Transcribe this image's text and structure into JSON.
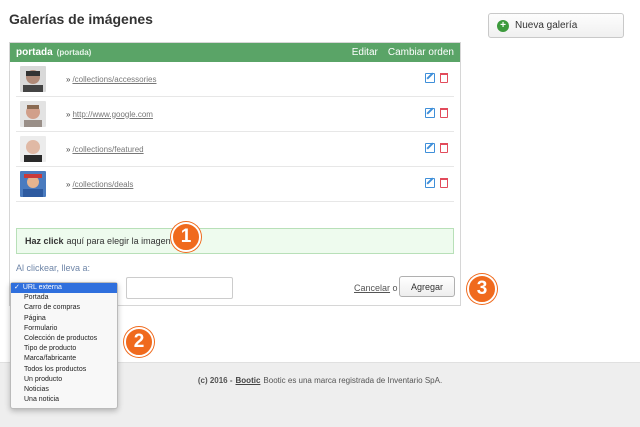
{
  "page": {
    "title": "Galerías de imágenes"
  },
  "sidebar": {
    "new_gallery_label": "Nueva galería"
  },
  "gallery": {
    "name": "portada",
    "handle": "(portada)",
    "edit_label": "Editar",
    "reorder_label": "Cambiar orden",
    "items": [
      {
        "raquo": "»",
        "link": "/collections/accessories"
      },
      {
        "raquo": "»",
        "link": "http://www.google.com"
      },
      {
        "raquo": "»",
        "link": "/collections/featured"
      },
      {
        "raquo": "»",
        "link": "/collections/deals"
      }
    ]
  },
  "upload": {
    "bold": "Haz click",
    "text": "aquí para elegir la imagen."
  },
  "form": {
    "link_label": "Al clickear, lleva a:",
    "url_value": "",
    "cancel_label": "Cancelar",
    "or_text": "o",
    "add_label": "Agregar"
  },
  "dropdown": {
    "check": "✓",
    "selected": "URL externa",
    "options": [
      "Portada",
      "Carro de compras",
      "Página",
      "Formulario",
      "Colección de productos",
      "Tipo de producto",
      "Marca/fabricante",
      "Todos los productos",
      "Un producto",
      "Noticias",
      "Una noticia"
    ]
  },
  "footer": {
    "year": "(c) 2016 -",
    "brand": "Bootic",
    "text": "Bootic es una marca registrada de Inventario SpA."
  },
  "badges": [
    "1",
    "2",
    "3"
  ],
  "colors": {
    "header_green": "#5aa467",
    "badge_orange": "#f06a1d",
    "select_blue": "#2f6fdd"
  }
}
